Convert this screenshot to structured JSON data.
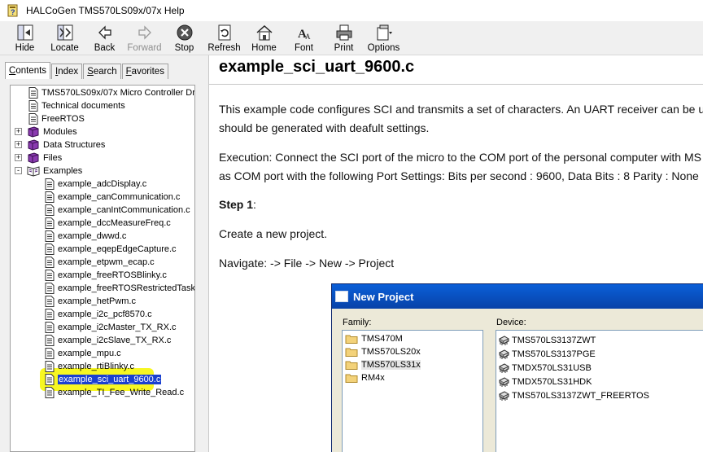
{
  "window": {
    "title": "HALCoGen TMS570LS09x/07x Help"
  },
  "toolbar": {
    "buttons": [
      {
        "label": "Hide",
        "icon": "hide-icon",
        "enabled": true
      },
      {
        "label": "Locate",
        "icon": "locate-icon",
        "enabled": true
      },
      {
        "label": "Back",
        "icon": "back-arrow-icon",
        "enabled": true
      },
      {
        "label": "Forward",
        "icon": "forward-arrow-icon",
        "enabled": false
      },
      {
        "label": "Stop",
        "icon": "stop-icon",
        "enabled": true
      },
      {
        "label": "Refresh",
        "icon": "refresh-icon",
        "enabled": true
      },
      {
        "label": "Home",
        "icon": "home-icon",
        "enabled": true
      },
      {
        "label": "Font",
        "icon": "font-icon",
        "enabled": true
      },
      {
        "label": "Print",
        "icon": "printer-icon",
        "enabled": true
      },
      {
        "label": "Options",
        "icon": "options-icon",
        "enabled": true
      }
    ]
  },
  "nav": {
    "tabs": [
      {
        "label": "Contents",
        "underline": "C",
        "rest": "ontents",
        "active": true
      },
      {
        "label": "Index",
        "underline": "I",
        "rest": "ndex",
        "active": false
      },
      {
        "label": "Search",
        "underline": "S",
        "rest": "earch",
        "active": false
      },
      {
        "label": "Favorites",
        "underline": "F",
        "rest": "avorites",
        "active": false
      }
    ],
    "tree": [
      {
        "label": "TMS570LS09x/07x Micro Controller Dri",
        "type": "page",
        "level": 1
      },
      {
        "label": "Technical documents",
        "type": "page",
        "level": 1
      },
      {
        "label": "FreeRTOS",
        "type": "page",
        "level": 1
      },
      {
        "label": "Modules",
        "type": "book",
        "level": 0,
        "expander": "+"
      },
      {
        "label": "Data Structures",
        "type": "book",
        "level": 0,
        "expander": "+"
      },
      {
        "label": "Files",
        "type": "book",
        "level": 0,
        "expander": "+"
      },
      {
        "label": "Examples",
        "type": "openbook",
        "level": 0,
        "expander": "-"
      },
      {
        "label": "example_adcDisplay.c",
        "type": "page",
        "level": 2
      },
      {
        "label": "example_canCommunication.c",
        "type": "page",
        "level": 2
      },
      {
        "label": "example_canIntCommunication.c",
        "type": "page",
        "level": 2
      },
      {
        "label": "example_dccMeasureFreq.c",
        "type": "page",
        "level": 2
      },
      {
        "label": "example_dwwd.c",
        "type": "page",
        "level": 2
      },
      {
        "label": "example_eqepEdgeCapture.c",
        "type": "page",
        "level": 2
      },
      {
        "label": "example_etpwm_ecap.c",
        "type": "page",
        "level": 2
      },
      {
        "label": "example_freeRTOSBlinky.c",
        "type": "page",
        "level": 2
      },
      {
        "label": "example_freeRTOSRestrictedTask",
        "type": "page",
        "level": 2
      },
      {
        "label": "example_hetPwm.c",
        "type": "page",
        "level": 2
      },
      {
        "label": "example_i2c_pcf8570.c",
        "type": "page",
        "level": 2
      },
      {
        "label": "example_i2cMaster_TX_RX.c",
        "type": "page",
        "level": 2
      },
      {
        "label": "example_i2cSlave_TX_RX.c",
        "type": "page",
        "level": 2
      },
      {
        "label": "example_mpu.c",
        "type": "page",
        "level": 2
      },
      {
        "label": "example_rtiBlinky.c",
        "type": "page",
        "level": 2
      },
      {
        "label": "example_sci_uart_9600.c",
        "type": "page",
        "level": 2,
        "selected": true
      },
      {
        "label": "example_TI_Fee_Write_Read.c",
        "type": "page",
        "level": 2
      }
    ],
    "highlight_color": "#f7f722",
    "selection_color": "#1a40d0"
  },
  "content": {
    "title": "example_sci_uart_9600.c",
    "paragraphs": [
      "This example code configures SCI and transmits a set of characters. An UART receiver can be u",
      "should be generated with deafult settings.",
      "Execution: Connect the SCI port of the micro to the COM port of the personal computer with MS",
      "as COM port with the following Port Settings: Bits per second : 9600, Data Bits : 8 Parity : None",
      "Step 1",
      ":",
      "Create a new project.",
      "Navigate: -> File -> New -> Project"
    ]
  },
  "dialog": {
    "title": "New Project",
    "family_label": "Family:",
    "device_label": "Device:",
    "families": [
      {
        "label": "TMS470M",
        "selected": false
      },
      {
        "label": "TMS570LS20x",
        "selected": false
      },
      {
        "label": "TMS570LS31x",
        "selected": true
      },
      {
        "label": "RM4x",
        "selected": false
      }
    ],
    "devices": [
      "TMS570LS3137ZWT",
      "TMS570LS3137PGE",
      "TMDX570LS31USB",
      "TMDX570LS31HDK",
      "TMS570LS3137ZWT_FREERTOS"
    ],
    "titlebar_color": "#0a4fc8"
  }
}
